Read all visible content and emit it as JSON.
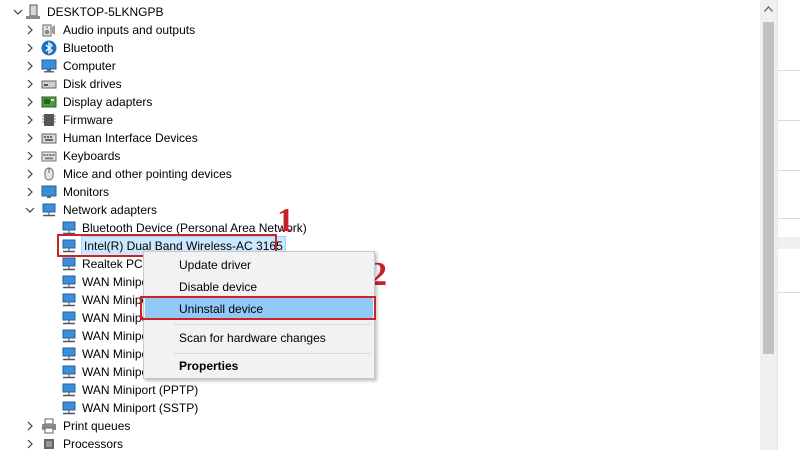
{
  "tree": {
    "root": "DESKTOP-5LKNGPB",
    "categories": [
      {
        "label": "Audio inputs and outputs",
        "icon": "speaker-icon"
      },
      {
        "label": "Bluetooth",
        "icon": "bluetooth-icon"
      },
      {
        "label": "Computer",
        "icon": "computer-icon"
      },
      {
        "label": "Disk drives",
        "icon": "disk-drive-icon"
      },
      {
        "label": "Display adapters",
        "icon": "display-adapter-icon"
      },
      {
        "label": "Firmware",
        "icon": "firmware-icon"
      },
      {
        "label": "Human Interface Devices",
        "icon": "hid-icon"
      },
      {
        "label": "Keyboards",
        "icon": "keyboard-icon"
      },
      {
        "label": "Mice and other pointing devices",
        "icon": "mouse-icon"
      },
      {
        "label": "Monitors",
        "icon": "monitor-icon"
      },
      {
        "label": "Network adapters",
        "icon": "network-adapter-icon"
      }
    ],
    "network_children": [
      "Bluetooth Device (Personal Area Network)",
      "Intel(R) Dual Band Wireless-AC 3165",
      "Realtek PCIe",
      "WAN Minipo",
      "WAN Minipo",
      "WAN Minipo",
      "WAN Minipo",
      "WAN Minipo",
      "WAN Minipo",
      "WAN Miniport (PPTP)",
      "WAN Miniport (SSTP)"
    ],
    "after": [
      {
        "label": "Print queues",
        "icon": "printer-icon"
      },
      {
        "label": "Processors",
        "icon": "processor-icon"
      }
    ]
  },
  "context_menu": {
    "items": [
      "Update driver",
      "Disable device",
      "Uninstall device",
      "Scan for hardware changes",
      "Properties"
    ],
    "highlighted": "Uninstall device"
  },
  "annotations": {
    "step1": "1",
    "step2": "2"
  },
  "colors": {
    "annotation": "#d0202a",
    "selection": "#cce8ff",
    "menu_highlight": "#91c9f7"
  }
}
